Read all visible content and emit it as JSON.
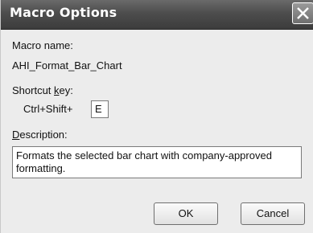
{
  "window": {
    "title": "Macro Options"
  },
  "macro_name": {
    "label": "Macro name:",
    "value": "AHI_Format_Bar_Chart"
  },
  "shortcut": {
    "label_prefix": "Shortcut ",
    "label_accel": "k",
    "label_suffix": "ey:",
    "modifier_text": "Ctrl+Shift+",
    "key_value": "E"
  },
  "description": {
    "label_accel": "D",
    "label_rest": "escription:",
    "value": "Formats the selected bar chart with company-approved formatting."
  },
  "buttons": {
    "ok_label": "OK",
    "cancel_label": "Cancel"
  },
  "icons": {
    "close": "close-icon"
  },
  "colors": {
    "titlebar": "#4d4d4d",
    "title_text": "#ffffff",
    "dialog_bg": "#ececec"
  }
}
